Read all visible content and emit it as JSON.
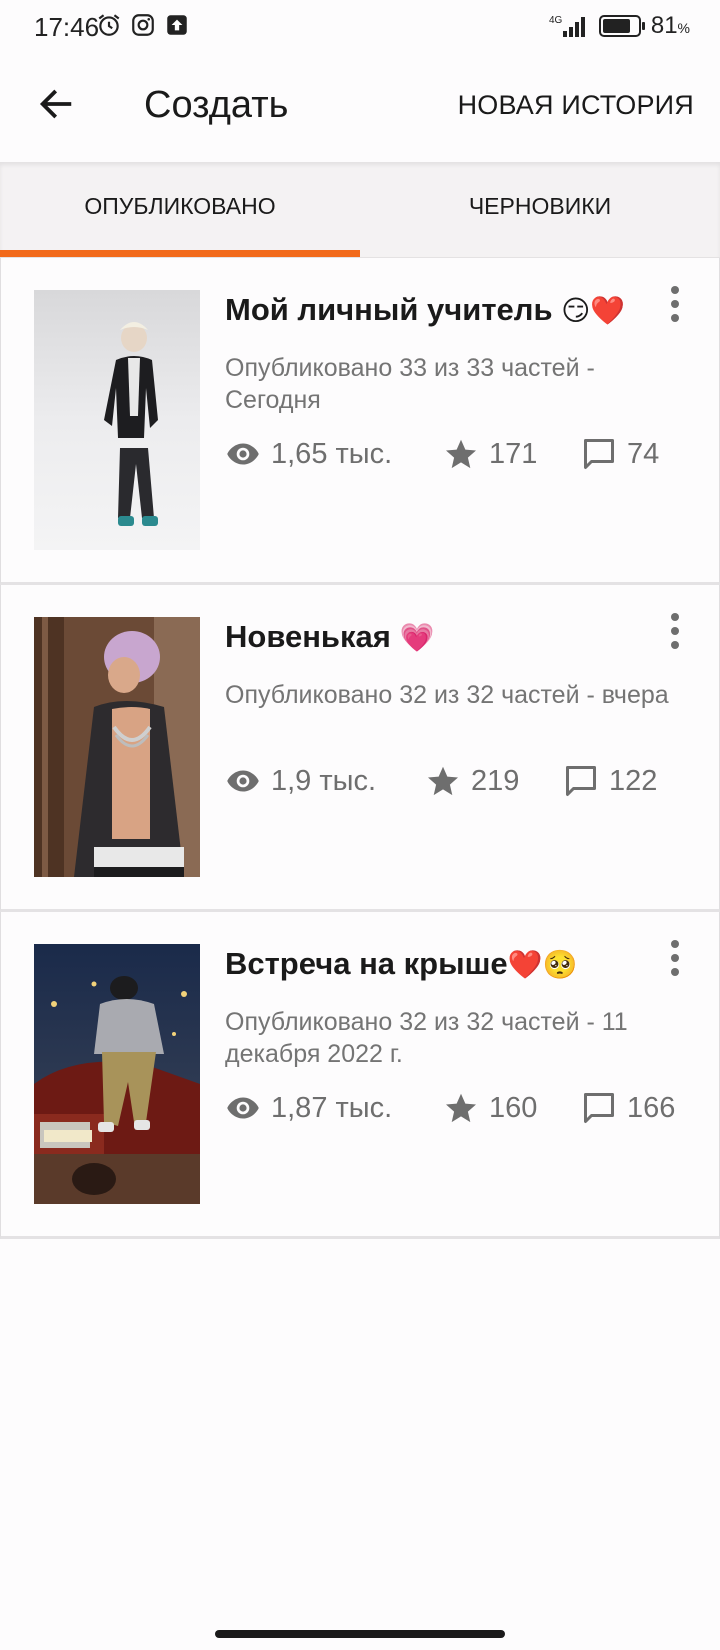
{
  "status": {
    "time": "17:46",
    "network": "4G",
    "battery": "81",
    "battery_unit": "%",
    "battery_level": 0.81,
    "icons": [
      "alarm-icon",
      "instagram-icon",
      "upload-icon",
      "signal-icon",
      "battery-icon"
    ]
  },
  "header": {
    "title": "Создать",
    "action": "НОВАЯ ИСТОРИЯ",
    "back_icon": "arrow-left-icon"
  },
  "tabs": [
    {
      "label": "ОПУБЛИКОВАНО",
      "active": true
    },
    {
      "label": "ЧЕРНОВИКИ",
      "active": false
    }
  ],
  "accent_color": "#f26a1b",
  "stories": [
    {
      "title": "Мой личный учитель ",
      "title_emoji": "😏❤️",
      "meta": "Опубликовано 33 из 33 частей - Сегодня",
      "views": "1,65 тыс.",
      "votes": "171",
      "comments": "74"
    },
    {
      "title": "Новенькая ",
      "title_emoji": "💗",
      "meta": "Опубликовано 32 из 32 частей - вчера",
      "views": "1,9 тыс.",
      "votes": "219",
      "comments": "122"
    },
    {
      "title": "Встреча на крыше",
      "title_emoji": "❤️🥺",
      "meta": "Опубликовано 32 из 32 частей - 11 декабря 2022 г.",
      "views": "1,87 тыс.",
      "votes": "160",
      "comments": "166"
    }
  ]
}
